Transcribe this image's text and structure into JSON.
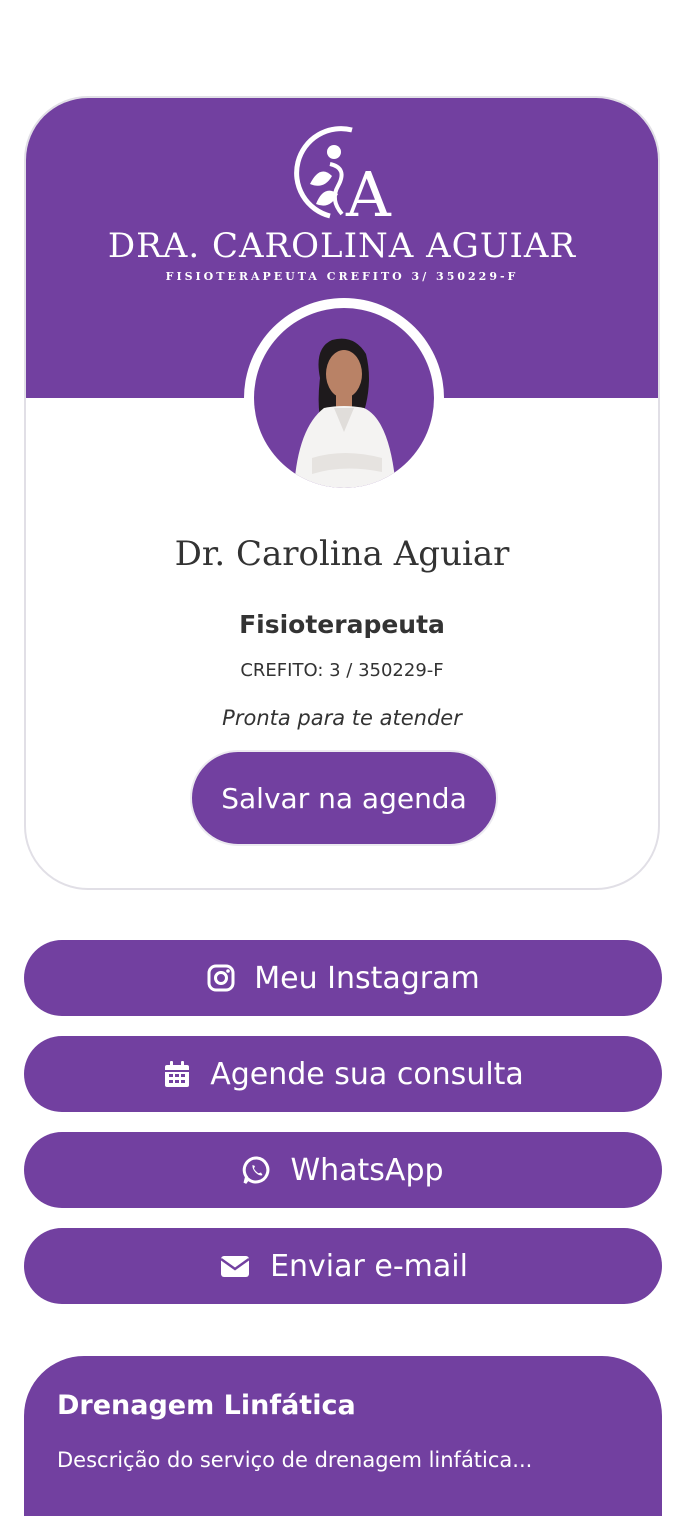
{
  "brand": {
    "accent_color": "#7240a0",
    "logo_initials": "A",
    "logo_name": "DRA. CAROLINA AGUIAR",
    "logo_subtitle": "FISIOTERAPEUTA CREFITO 3/ 350229-F"
  },
  "profile": {
    "name": "Dr. Carolina Aguiar",
    "role": "Fisioterapeuta",
    "crefito": "CREFITO: 3 / 350229-F",
    "tagline": "Pronta para te atender",
    "save_label": "Salvar na agenda",
    "avatar_icon": "profile-photo"
  },
  "links": [
    {
      "label": "Meu Instagram",
      "icon": "instagram-icon"
    },
    {
      "label": "Agende sua consulta",
      "icon": "calendar-icon"
    },
    {
      "label": "WhatsApp",
      "icon": "whatsapp-icon"
    },
    {
      "label": "Enviar e-mail",
      "icon": "envelope-icon"
    }
  ],
  "services": [
    {
      "title": "Drenagem Linfática",
      "description": "Descrição do serviço de drenagem linfática..."
    }
  ]
}
